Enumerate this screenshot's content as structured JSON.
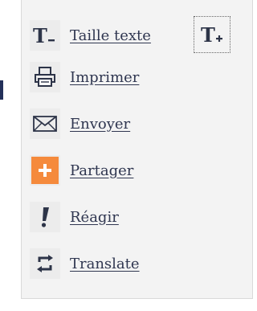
{
  "menu": {
    "items": [
      {
        "label": "Taille texte",
        "icon": "text-size-decrease-icon"
      },
      {
        "label": "Imprimer",
        "icon": "printer-icon"
      },
      {
        "label": "Envoyer",
        "icon": "envelope-icon"
      },
      {
        "label": "Partager",
        "icon": "share-plus-icon"
      },
      {
        "label": "Réagir",
        "icon": "exclamation-icon"
      },
      {
        "label": "Translate",
        "icon": "refresh-arrows-icon"
      }
    ],
    "increase_text_icon": "text-size-increase-icon"
  },
  "colors": {
    "panel_background": "#f3f3f3",
    "text": "#2f3650",
    "icon": "#2d3448",
    "share_accent": "#f58a3c"
  }
}
